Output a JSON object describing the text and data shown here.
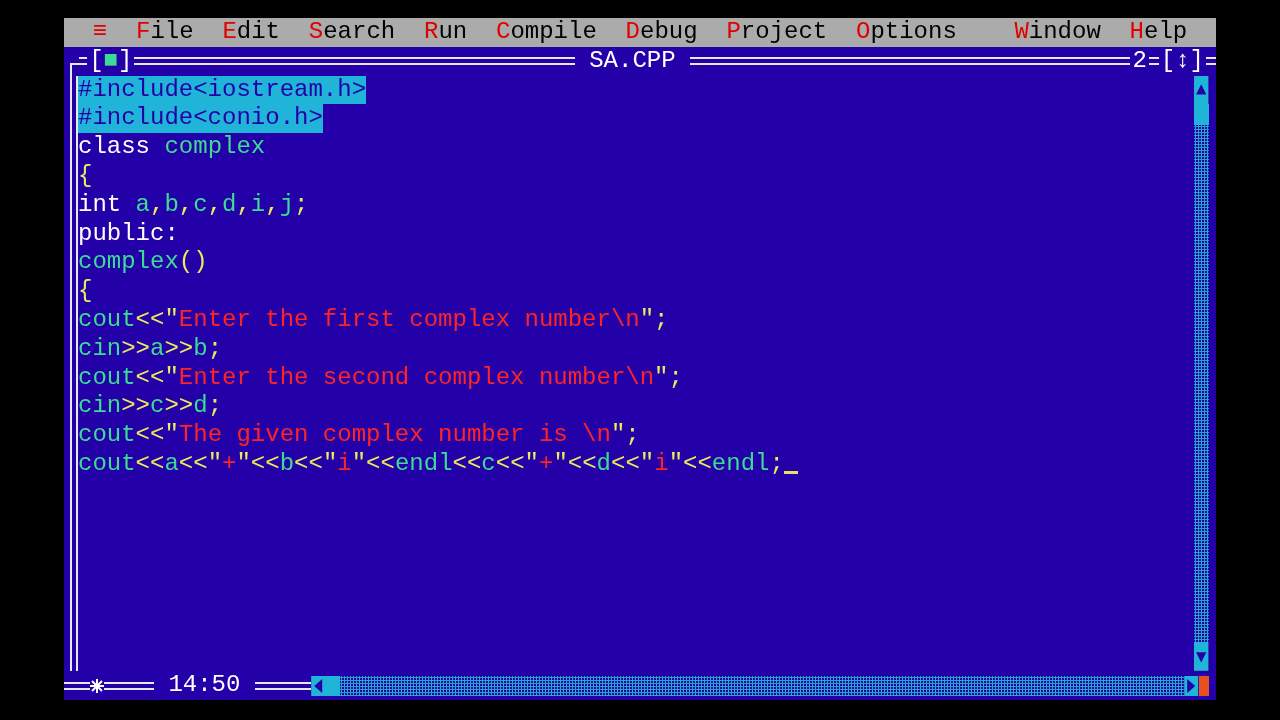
{
  "menu": {
    "system": "≡",
    "left": [
      "File",
      "Edit",
      "Search",
      "Run",
      "Compile",
      "Debug",
      "Project",
      "Options"
    ],
    "right": [
      "Window",
      "Help"
    ]
  },
  "window": {
    "title": "SA.CPP",
    "close_box": "[■]",
    "number": "2",
    "zoom_box": "[↕]",
    "modified": true,
    "position": "14:50"
  },
  "editor": {
    "lines": [
      {
        "selected": true,
        "cursor": false,
        "tokens": [
          {
            "text": "#include<iostream.h>",
            "kind": "plain"
          }
        ]
      },
      {
        "selected": true,
        "cursor": false,
        "tokens": [
          {
            "text": "#include<conio.h>",
            "kind": "plain"
          }
        ]
      },
      {
        "selected": false,
        "cursor": false,
        "tokens": [
          {
            "text": "class ",
            "kind": "keyword"
          },
          {
            "text": "complex",
            "kind": "ident"
          }
        ]
      },
      {
        "selected": false,
        "cursor": false,
        "tokens": [
          {
            "text": "{",
            "kind": "symbol"
          }
        ]
      },
      {
        "selected": false,
        "cursor": false,
        "tokens": [
          {
            "text": "int ",
            "kind": "keyword"
          },
          {
            "text": "a",
            "kind": "ident"
          },
          {
            "text": ",",
            "kind": "symbol"
          },
          {
            "text": "b",
            "kind": "ident"
          },
          {
            "text": ",",
            "kind": "symbol"
          },
          {
            "text": "c",
            "kind": "ident"
          },
          {
            "text": ",",
            "kind": "symbol"
          },
          {
            "text": "d",
            "kind": "ident"
          },
          {
            "text": ",",
            "kind": "symbol"
          },
          {
            "text": "i",
            "kind": "ident"
          },
          {
            "text": ",",
            "kind": "symbol"
          },
          {
            "text": "j",
            "kind": "ident"
          },
          {
            "text": ";",
            "kind": "symbol"
          }
        ]
      },
      {
        "selected": false,
        "cursor": false,
        "tokens": [
          {
            "text": "public:",
            "kind": "keyword"
          }
        ]
      },
      {
        "selected": false,
        "cursor": false,
        "tokens": [
          {
            "text": "complex",
            "kind": "ident"
          },
          {
            "text": "()",
            "kind": "symbol"
          }
        ]
      },
      {
        "selected": false,
        "cursor": false,
        "tokens": [
          {
            "text": "{",
            "kind": "symbol"
          }
        ]
      },
      {
        "selected": false,
        "cursor": false,
        "tokens": [
          {
            "text": "cout",
            "kind": "ident"
          },
          {
            "text": "<<\"",
            "kind": "symbol"
          },
          {
            "text": "Enter the first complex number\\n",
            "kind": "string"
          },
          {
            "text": "\";",
            "kind": "symbol"
          }
        ]
      },
      {
        "selected": false,
        "cursor": false,
        "tokens": [
          {
            "text": "cin",
            "kind": "ident"
          },
          {
            "text": ">>",
            "kind": "symbol"
          },
          {
            "text": "a",
            "kind": "ident"
          },
          {
            "text": ">>",
            "kind": "symbol"
          },
          {
            "text": "b",
            "kind": "ident"
          },
          {
            "text": ";",
            "kind": "symbol"
          }
        ]
      },
      {
        "selected": false,
        "cursor": false,
        "tokens": [
          {
            "text": "cout",
            "kind": "ident"
          },
          {
            "text": "<<\"",
            "kind": "symbol"
          },
          {
            "text": "Enter the second complex number\\n",
            "kind": "string"
          },
          {
            "text": "\";",
            "kind": "symbol"
          }
        ]
      },
      {
        "selected": false,
        "cursor": false,
        "tokens": [
          {
            "text": "cin",
            "kind": "ident"
          },
          {
            "text": ">>",
            "kind": "symbol"
          },
          {
            "text": "c",
            "kind": "ident"
          },
          {
            "text": ">>",
            "kind": "symbol"
          },
          {
            "text": "d",
            "kind": "ident"
          },
          {
            "text": ";",
            "kind": "symbol"
          }
        ]
      },
      {
        "selected": false,
        "cursor": false,
        "tokens": [
          {
            "text": "cout",
            "kind": "ident"
          },
          {
            "text": "<<\"",
            "kind": "symbol"
          },
          {
            "text": "The given complex number is \\n",
            "kind": "string"
          },
          {
            "text": "\";",
            "kind": "symbol"
          }
        ]
      },
      {
        "selected": false,
        "cursor": true,
        "tokens": [
          {
            "text": "cout",
            "kind": "ident"
          },
          {
            "text": "<<",
            "kind": "symbol"
          },
          {
            "text": "a",
            "kind": "ident"
          },
          {
            "text": "<<\"",
            "kind": "symbol"
          },
          {
            "text": "+",
            "kind": "string"
          },
          {
            "text": "\"<<",
            "kind": "symbol"
          },
          {
            "text": "b",
            "kind": "ident"
          },
          {
            "text": "<<\"",
            "kind": "symbol"
          },
          {
            "text": "i",
            "kind": "string"
          },
          {
            "text": "\"<<",
            "kind": "symbol"
          },
          {
            "text": "endl",
            "kind": "ident"
          },
          {
            "text": "<<",
            "kind": "symbol"
          },
          {
            "text": "c",
            "kind": "ident"
          },
          {
            "text": "<<\"",
            "kind": "symbol"
          },
          {
            "text": "+",
            "kind": "string"
          },
          {
            "text": "\"<<",
            "kind": "symbol"
          },
          {
            "text": "d",
            "kind": "ident"
          },
          {
            "text": "<<\"",
            "kind": "symbol"
          },
          {
            "text": "i",
            "kind": "string"
          },
          {
            "text": "\"<<",
            "kind": "symbol"
          },
          {
            "text": "endl",
            "kind": "ident"
          },
          {
            "text": ";",
            "kind": "symbol"
          }
        ]
      }
    ]
  }
}
